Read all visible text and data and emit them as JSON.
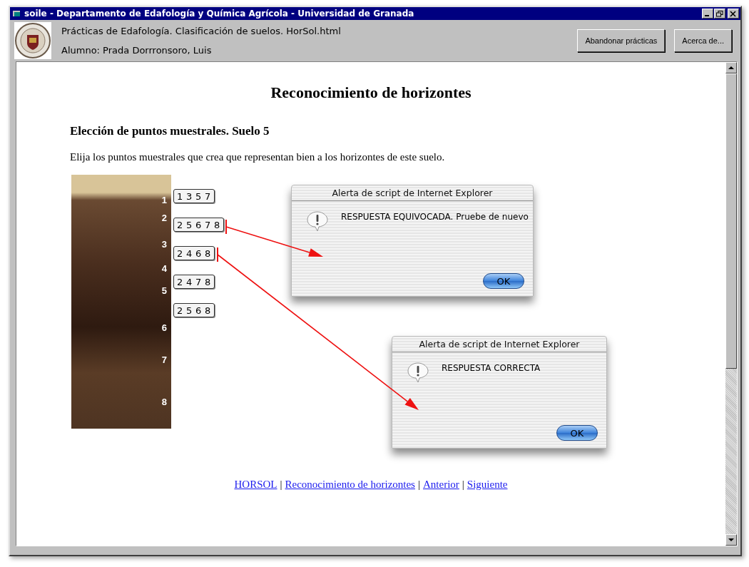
{
  "window": {
    "title": "soile - Departamento de Edafología y Química Agrícola - Universidad de Granada"
  },
  "header": {
    "lines": [
      "Prácticas de Edafología. Clasificación de suelos. HorSol.html",
      "Alumno: Prada Dorrronsoro, Luis"
    ],
    "buttons": [
      "Abandonar prácticas",
      "Acerca de..."
    ]
  },
  "page": {
    "title": "Reconocimiento de horizontes",
    "subtitle": "Elección de puntos muestrales. Suelo 5",
    "instruction": "Elija los puntos muestrales que crea que representan bien a los horizontes de este suelo.",
    "depth_marks": [
      "1",
      "2",
      "3",
      "4",
      "5",
      "6",
      "7",
      "8"
    ],
    "options": [
      "1 3 5 7",
      "2 5 6 7 8",
      "2 4 6 8",
      "2 4 7 8",
      "2 5 6 8"
    ]
  },
  "alerts": [
    {
      "title": "Alerta de script de Internet Explorer",
      "message": "RESPUESTA EQUIVOCADA. Pruebe de nuevo",
      "button": "OK"
    },
    {
      "title": "Alerta de script de Internet Explorer",
      "message": "RESPUESTA CORRECTA",
      "button": "OK"
    }
  ],
  "footer": [
    {
      "kind": "link",
      "text": "HORSOL"
    },
    {
      "kind": "separator",
      "text": "|"
    },
    {
      "kind": "link",
      "text": "Reconocimiento de horizontes"
    },
    {
      "kind": "separator",
      "text": "|"
    },
    {
      "kind": "link",
      "text": "Anterior"
    },
    {
      "kind": "separator",
      "text": "|"
    },
    {
      "kind": "link",
      "text": "Siguiente"
    }
  ]
}
